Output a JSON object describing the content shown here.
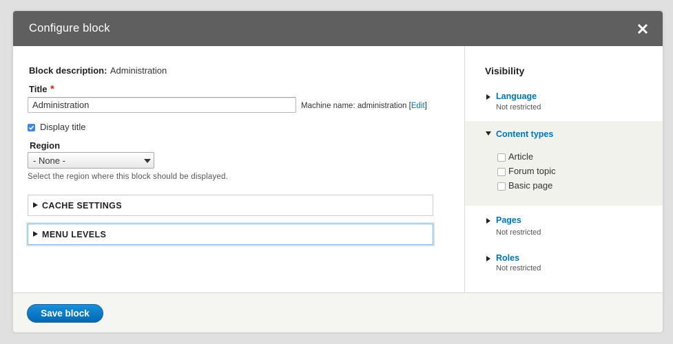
{
  "dialog": {
    "title": "Configure block",
    "close_icon": "close-icon"
  },
  "form": {
    "block_description_label": "Block description:",
    "block_description_value": "Administration",
    "title_label": "Title",
    "title_required_mark": "*",
    "title_value": "Administration",
    "machine_name_label": "Machine name: administration",
    "machine_name_edit_open": "[",
    "machine_name_edit_link": "Edit",
    "machine_name_edit_close": "]",
    "display_title_label": "Display title",
    "display_title_checked": true,
    "region_label": "Region",
    "region_selected": "- None -",
    "region_description": "Select the region where this block should be displayed.",
    "cache_settings_label": "CACHE SETTINGS",
    "menu_levels_label": "MENU LEVELS"
  },
  "visibility": {
    "title": "Visibility",
    "language_label": "Language",
    "language_status": "Not restricted",
    "content_types_label": "Content types",
    "content_types": [
      {
        "label": "Article",
        "checked": false
      },
      {
        "label": "Forum topic",
        "checked": false
      },
      {
        "label": "Basic page",
        "checked": false
      }
    ],
    "pages_label": "Pages",
    "pages_status": "Not restricted",
    "roles_label": "Roles",
    "roles_status": "Not restricted"
  },
  "footer": {
    "save_label": "Save block"
  },
  "colors": {
    "titlebar": "#5f5f5f",
    "link": "#0074bd",
    "primary_button": "#0074bd",
    "required": "#e62600",
    "panel_bg": "#f2f2ed"
  }
}
